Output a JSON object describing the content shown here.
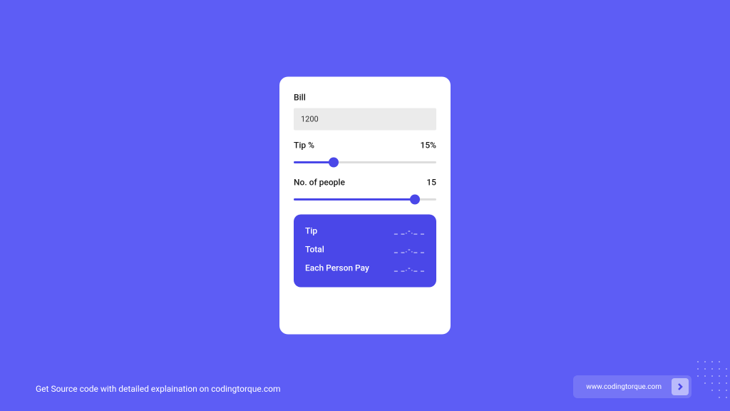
{
  "card": {
    "bill": {
      "label": "Bill",
      "value": "1200"
    },
    "tip": {
      "label": "Tip %",
      "value": "15%",
      "percent": 28
    },
    "people": {
      "label": "No. of people",
      "value": "15",
      "percent": 85
    },
    "results": {
      "tip": {
        "label": "Tip",
        "value": "_ _.-._ _"
      },
      "total": {
        "label": "Total",
        "value": "_ _.-._ _"
      },
      "each": {
        "label": "Each Person Pay",
        "value": "_ _.-._ _"
      }
    }
  },
  "footer": {
    "text": "Get Source code with detailed explaination on codingtorque.com",
    "button": {
      "label": "www.codingtorque.com"
    }
  }
}
